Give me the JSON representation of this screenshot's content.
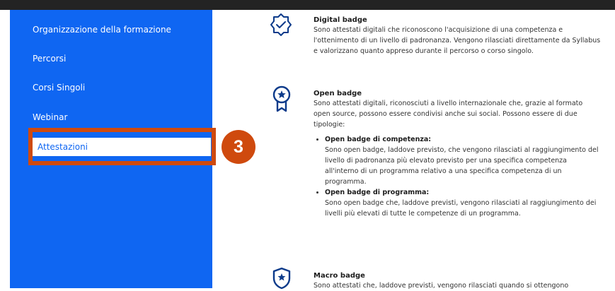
{
  "sidebar": {
    "items": [
      {
        "label": "Organizzazione della formazione"
      },
      {
        "label": "Percorsi"
      },
      {
        "label": "Corsi Singoli"
      },
      {
        "label": "Webinar"
      },
      {
        "label": "Attestazioni",
        "active": true
      }
    ]
  },
  "annotation": {
    "step": "3",
    "color": "#cf4a0e"
  },
  "colors": {
    "sidebar": "#0f66f2",
    "topbar": "#232323",
    "text": "#333333"
  },
  "content": {
    "digital": {
      "icon": "badge-check-icon",
      "title": "Digital badge",
      "text": "Sono attestati digitali che riconoscono l'acquisizione di una competenza e l'ottenimento di un livello di padronanza. Vengono rilasciati direttamente da Syllabus e valorizzano quanto appreso durante il percorso o corso singolo."
    },
    "open": {
      "icon": "award-ribbon-star-icon",
      "title": "Open badge",
      "text": "Sono attestati digitali, riconosciuti a livello internazionale che, grazie al formato open source, possono essere condivisi anche sui social. Possono essere di due tipologie:",
      "bullets": [
        {
          "title": "Open badge di competenza:",
          "text": "Sono open badge, laddove previsto, che vengono rilasciati al raggiungimento del livello di padronanza più elevato previsto per una specifica competenza all'interno di un programma relativo a una specifica competenza di un programma."
        },
        {
          "title": "Open badge di programma:",
          "text": "Sono open badge che, laddove previsti, vengono rilasciati al raggiungimento dei livelli più elevati di tutte le competenze di un programma."
        }
      ]
    },
    "macro": {
      "icon": "shield-star-icon",
      "title": "Macro badge",
      "text": "Sono attestati che, laddove previsti, vengono rilasciati quando si ottengono"
    }
  }
}
